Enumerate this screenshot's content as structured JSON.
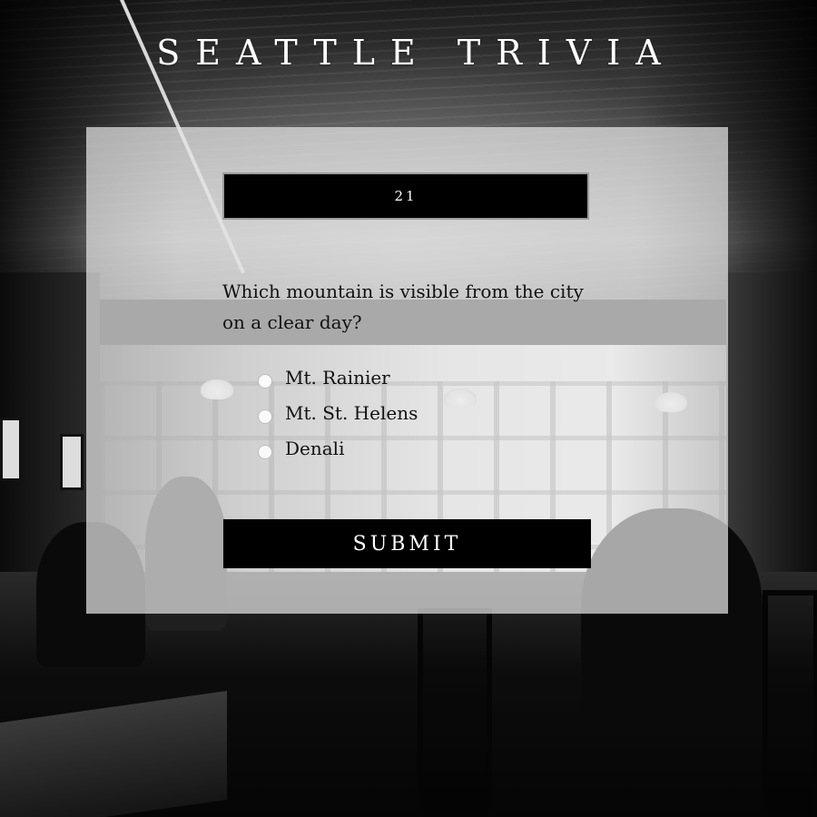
{
  "page": {
    "title": "SEATTLE TRIVIA"
  },
  "quiz": {
    "score": "21",
    "question": "Which mountain is visible from the city on a clear day?",
    "options": [
      {
        "label": "Mt. Rainier",
        "selected": false
      },
      {
        "label": "Mt. St. Helens",
        "selected": false
      },
      {
        "label": "Denali",
        "selected": false
      }
    ],
    "submit_label": "SUBMIT"
  },
  "colors": {
    "card_background": "#e4e4e4",
    "button_background": "#000000",
    "button_text": "#ffffff",
    "title_text": "#ffffff"
  }
}
